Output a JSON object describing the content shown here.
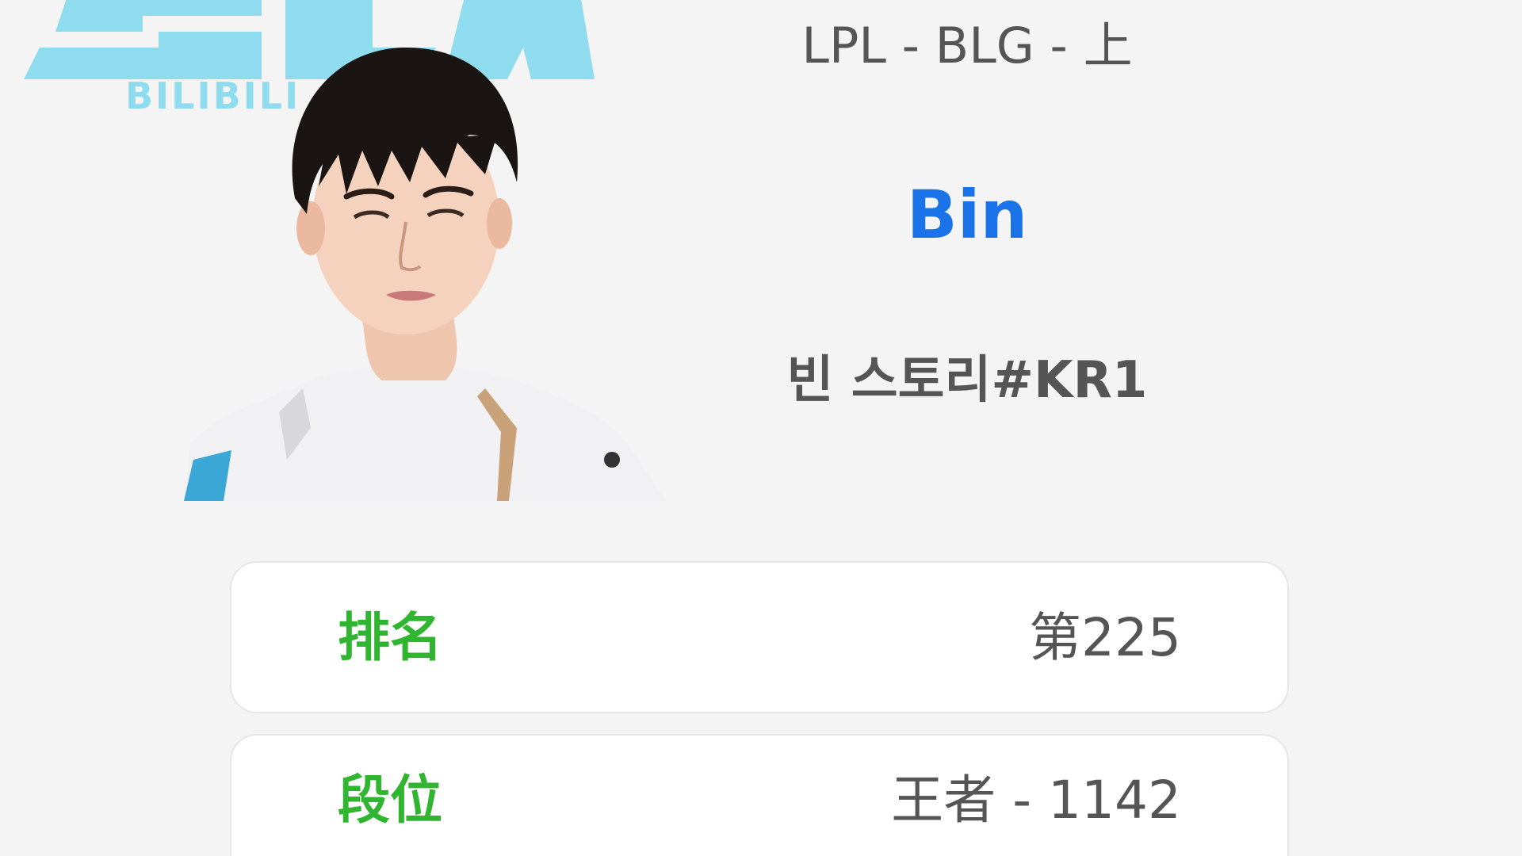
{
  "team_logo": {
    "wordmark": "BILIBILI",
    "icon": "team-logo",
    "color": "#8fdcef"
  },
  "player": {
    "league_line": "LPL - BLG - 上",
    "name": "Bin",
    "game_id": "빈 스토리#KR1",
    "name_color": "#1a73e8"
  },
  "stats": {
    "rank": {
      "label": "排名",
      "value": "第225"
    },
    "tier": {
      "label": "段位",
      "value": "王者 - 1142"
    },
    "label_color": "#2fb52f"
  }
}
